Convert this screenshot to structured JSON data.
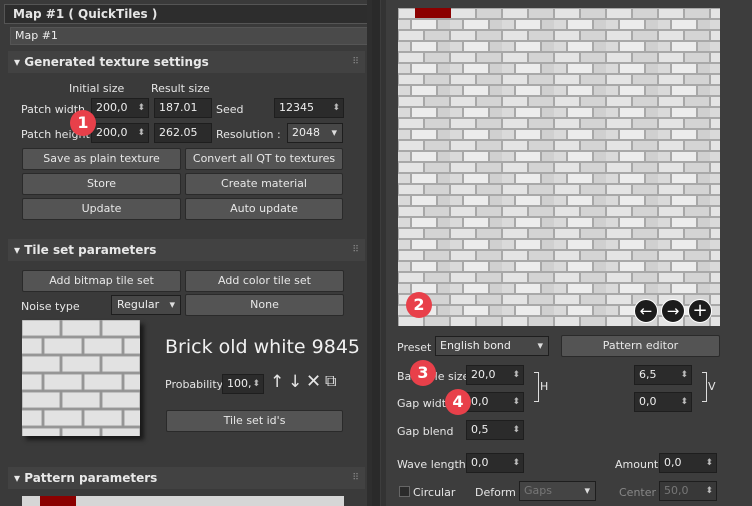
{
  "window": {
    "title": "Map #1  ( QuickTiles )"
  },
  "map_name": "Map #1",
  "generated": {
    "header": "Generated texture settings",
    "initial_size_label": "Initial size",
    "result_size_label": "Result size",
    "patch_width_label": "Patch width",
    "patch_width_value": "200,0",
    "patch_width_result": "187.01",
    "patch_height_label": "Patch height",
    "patch_height_value": "200,0",
    "patch_height_result": "262.05",
    "seed_label": "Seed",
    "seed_value": "12345",
    "resolution_label": "Resolution :",
    "resolution_value": "2048",
    "save_plain": "Save as plain texture",
    "convert_all": "Convert all QT to textures",
    "store": "Store",
    "create_material": "Create material",
    "update": "Update",
    "auto_update": "Auto update"
  },
  "tileset": {
    "header": "Tile set parameters",
    "add_bitmap": "Add bitmap tile set",
    "add_color": "Add color tile set",
    "noise_label": "Noise type",
    "noise_value": "Regular",
    "none_button": "None",
    "name": "Brick old white 9845",
    "probability_label": "Probability",
    "probability_value": "100,",
    "ids_button": "Tile set id's"
  },
  "pattern_header": "Pattern parameters",
  "pattern": {
    "preset_label": "Preset",
    "preset_value": "English bond",
    "pattern_editor": "Pattern editor",
    "base_tile_label": "Base tile size",
    "base_tile_h": "20,0",
    "base_tile_v": "6,5",
    "h_label": "H",
    "v_label": "V",
    "gap_width_label": "Gap width",
    "gap_width_h": "0,0",
    "gap_width_v": "0,0",
    "gap_blend_label": "Gap blend",
    "gap_blend_value": "0,5",
    "wave_length_label": "Wave length",
    "wave_length_value": "0,0",
    "amount_label": "Amount",
    "amount_value": "0,0",
    "circular_label": "Circular",
    "deform_label": "Deform",
    "deform_value": "Gaps",
    "center_label": "Center",
    "center_value": "50,0"
  },
  "badges": [
    "1",
    "2",
    "3",
    "4"
  ],
  "nav_icons": [
    "arrow-left-icon",
    "arrow-right-icon",
    "plus-icon"
  ],
  "colors": {
    "accent_red": "#e8404a",
    "panel": "#3d3d3d",
    "field": "#2b2b2b",
    "brick_red": "#8b0000"
  }
}
